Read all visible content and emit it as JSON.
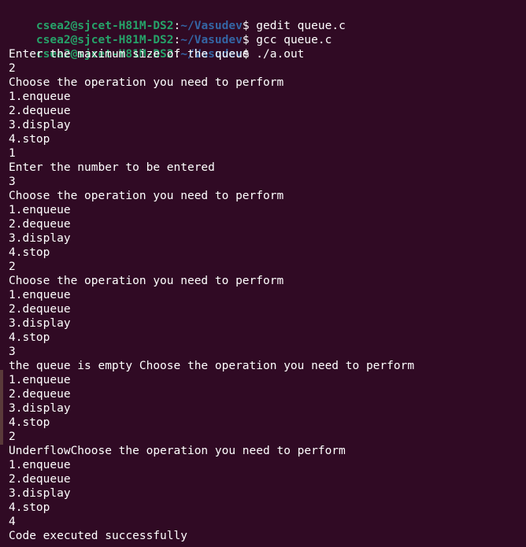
{
  "prompts": [
    {
      "user": "csea2@sjcet-H81M-DS2",
      "path": "~/Vasudev",
      "symbol": "$",
      "command": " gedit queue.c"
    },
    {
      "user": "csea2@sjcet-H81M-DS2",
      "path": "~/Vasudev",
      "symbol": "$",
      "command": " gcc queue.c"
    },
    {
      "user": "csea2@sjcet-H81M-DS2",
      "path": "~/Vasudev",
      "symbol": "$",
      "command": " ./a.out"
    }
  ],
  "output": [
    "Enter the maximum size of the queue",
    "2",
    "Choose the operation you need to perform",
    "1.enqueue",
    "2.dequeue",
    "3.display",
    "4.stop",
    "1",
    "Enter the number to be entered",
    "3",
    "Choose the operation you need to perform",
    "1.enqueue",
    "2.dequeue",
    "3.display",
    "4.stop",
    "2",
    "Choose the operation you need to perform",
    "1.enqueue",
    "2.dequeue",
    "3.display",
    "4.stop",
    "3",
    "the queue is empty Choose the operation you need to perform",
    "1.enqueue",
    "2.dequeue",
    "3.display",
    "4.stop",
    "2",
    "UnderflowChoose the operation you need to perform",
    "1.enqueue",
    "2.dequeue",
    "3.display",
    "4.stop",
    "4",
    "Code executed successfully"
  ],
  "colors": {
    "background": "#300a24",
    "user": "#26a269",
    "path": "#3465a4",
    "text": "#ffffff"
  }
}
